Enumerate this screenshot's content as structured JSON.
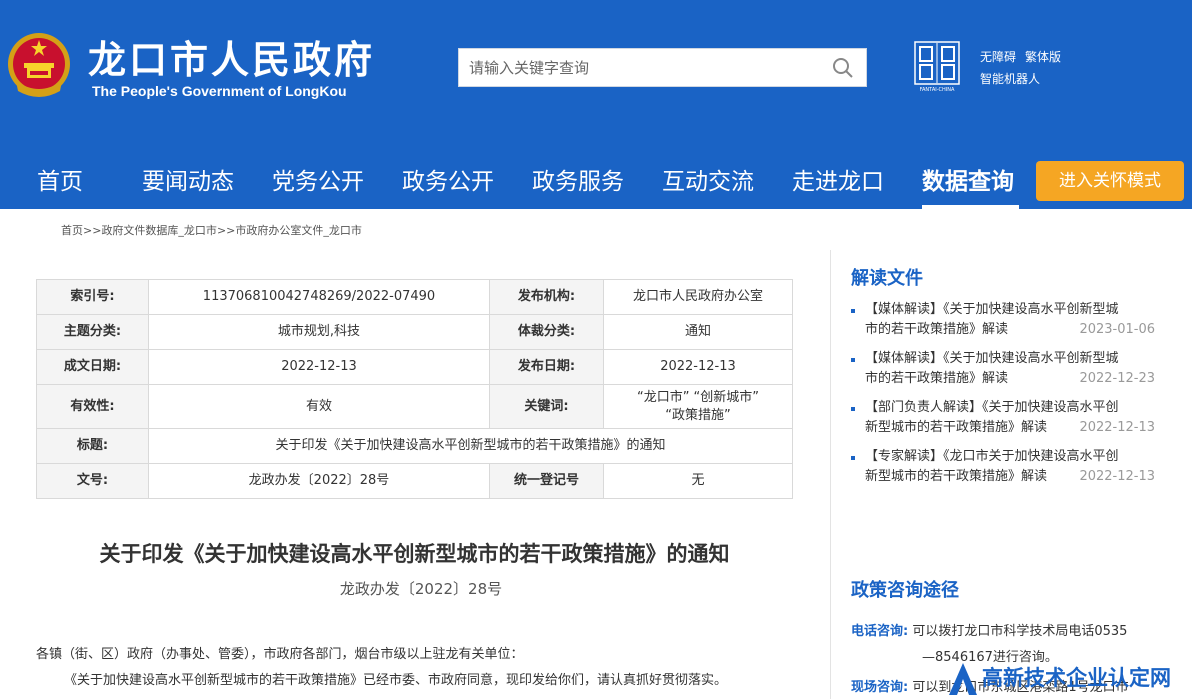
{
  "header": {
    "site_title": "龙口市人民政府",
    "site_subtitle": "The People's Government of LongKou",
    "search_placeholder": "请输入关键字查询",
    "top_links": [
      "无障碍",
      "繁体版",
      "智能机器人"
    ],
    "logo_caption": "FANTAI-CHINA"
  },
  "nav": {
    "items": [
      "首页",
      "要闻动态",
      "党务公开",
      "政务公开",
      "政务服务",
      "互动交流",
      "走进龙口",
      "数据查询"
    ],
    "active": "数据查询",
    "care_mode_label": "进入关怀模式"
  },
  "breadcrumb": [
    "首页",
    "政府文件数据库_龙口市",
    "市政府办公室文件_龙口市"
  ],
  "breadcrumb_separator": ">>",
  "info_table": {
    "index_label": "索引号:",
    "index_value": "113706810042748269/2022-07490",
    "org_label": "发布机构:",
    "org_value": "龙口市人民政府办公室",
    "topic_label": "主题分类:",
    "topic_value": "城市规划,科技",
    "genre_label": "体裁分类:",
    "genre_value": "通知",
    "created_label": "成文日期:",
    "created_value": "2022-12-13",
    "published_label": "发布日期:",
    "published_value": "2022-12-13",
    "validity_label": "有效性:",
    "validity_value": "有效",
    "keywords_label": "关键词:",
    "keywords_line1": "“龙口市” “创新城市”",
    "keywords_line2": "“政策措施”",
    "title_label": "标题:",
    "title_value": "关于印发《关于加快建设高水平创新型城市的若干政策措施》的通知",
    "docno_label": "文号:",
    "docno_value": "龙政办发〔2022〕28号",
    "reg_label": "统一登记号",
    "reg_value": "无"
  },
  "document": {
    "title": "关于印发《关于加快建设高水平创新型城市的若干政策措施》的通知",
    "number": "龙政办发〔2022〕28号",
    "para1": "各镇（街、区）政府（办事处、管委），市政府各部门，烟台市级以上驻龙有关单位：",
    "para2": "《关于加快建设高水平创新型城市的若干政策措施》已经市委、市政府同意，现印发给你们，请认真抓好贯彻落实。"
  },
  "sidebar": {
    "interpret_heading": "解读文件",
    "interpret_items": [
      {
        "line1": "【媒体解读】《关于加快建设高水平创新型城",
        "line2": "市的若干政策措施》解读",
        "date": "2023-01-06"
      },
      {
        "line1": "【媒体解读】《关于加快建设高水平创新型城",
        "line2": "市的若干政策措施》解读",
        "date": "2022-12-23"
      },
      {
        "line1": "【部门负责人解读】《关于加快建设高水平创",
        "line2": "新型城市的若干政策措施》解读",
        "date": "2022-12-13"
      },
      {
        "line1": "【专家解读】《龙口市关于加快建设高水平创",
        "line2": "新型城市的若干政策措施》解读",
        "date": "2022-12-13"
      }
    ],
    "consult_heading": "政策咨询途径",
    "phone_label": "电话咨询:",
    "phone_line1": "可以拨打龙口市科学技术局电话0535",
    "phone_line2": "—8546167进行咨询。",
    "onsite_label": "现场咨询:",
    "onsite_text": "可以到龙口市东城区港栾路1号龙口市"
  },
  "watermark": {
    "text": "高新技术企业认定网"
  },
  "colors": {
    "brand_blue": "#1a63c5",
    "care_orange": "#f5a623"
  }
}
